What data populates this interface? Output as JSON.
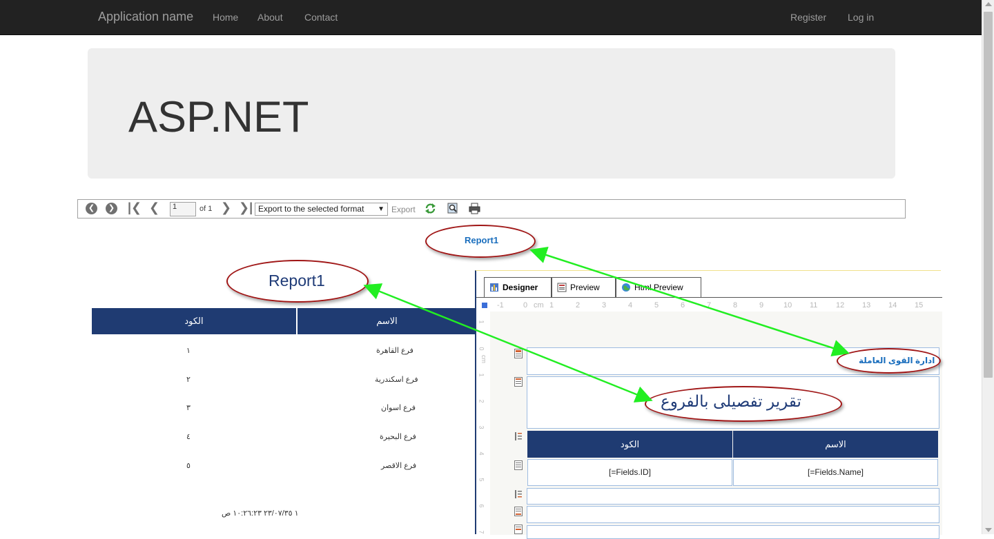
{
  "navbar": {
    "brand": "Application name",
    "links": [
      "Home",
      "About",
      "Contact"
    ],
    "right_links": [
      "Register",
      "Log in"
    ]
  },
  "jumbotron": {
    "title": "ASP.NET"
  },
  "toolbar": {
    "page_value": "1",
    "page_of": "of 1",
    "export_format": "Export to the selected format",
    "export_label": "Export"
  },
  "report": {
    "title_small": "Report1",
    "title_big": "Report1",
    "columns": [
      "الكود",
      "الاسم"
    ],
    "rows": [
      {
        "code": "١",
        "name": "فرع القاهرة"
      },
      {
        "code": "٢",
        "name": "فرع اسكندرية"
      },
      {
        "code": "٣",
        "name": "فرع اسوان"
      },
      {
        "code": "٤",
        "name": "فرع البحيرة"
      },
      {
        "code": "٥",
        "name": "فرع الاقصر"
      }
    ],
    "footer": "١ ٢٣/٠٧/٣٥ ١٠:٢٦:٢٣ ص"
  },
  "designer": {
    "tabs": [
      "Designer",
      "Preview",
      "Html Preview"
    ],
    "ruler": [
      "-1",
      "0",
      "cm",
      "1",
      "2",
      "3",
      "4",
      "5",
      "6",
      "7",
      "8",
      "9",
      "10",
      "11",
      "12",
      "13",
      "14",
      "15"
    ],
    "vruler": [
      "1",
      "0",
      "cm",
      "1",
      "2",
      "3",
      "4",
      "5",
      "6",
      "7"
    ],
    "page_header_text": "ادارة القوى العاملة",
    "report_subtitle": "تقرير تفصيلى بالفروع",
    "columns": [
      "الكود",
      "الاسم"
    ],
    "fields": [
      "[=Fields.ID]",
      "[=Fields.Name]"
    ]
  },
  "colors": {
    "navbar": "#222222",
    "header_blue": "#1f3b72",
    "annotation_red": "#a01515",
    "arrow_green": "#22ee22"
  }
}
